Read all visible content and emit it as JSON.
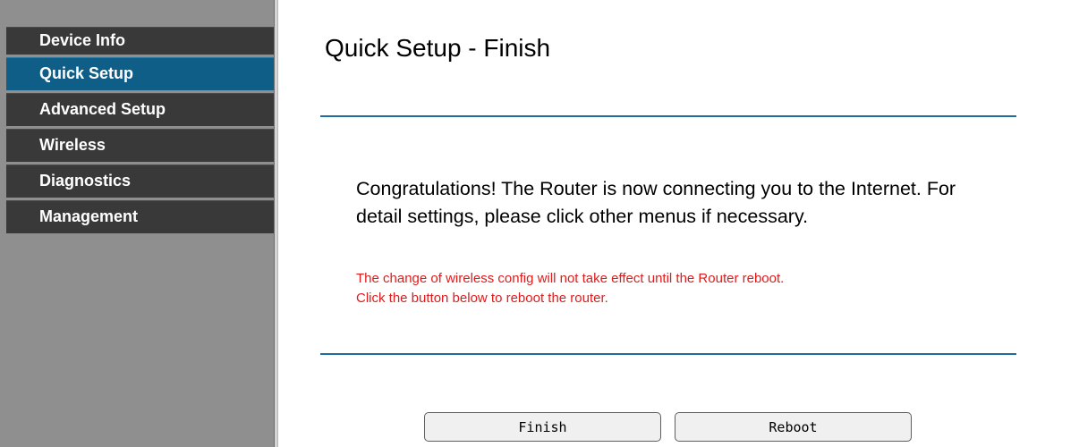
{
  "sidebar": {
    "items": [
      {
        "label": "Device Info",
        "active": false
      },
      {
        "label": "Quick Setup",
        "active": true
      },
      {
        "label": "Advanced Setup",
        "active": false
      },
      {
        "label": "Wireless",
        "active": false
      },
      {
        "label": "Diagnostics",
        "active": false
      },
      {
        "label": "Management",
        "active": false
      }
    ]
  },
  "main": {
    "title": "Quick Setup - Finish",
    "message": "Congratulations! The Router is now connecting you to the Internet. For detail settings, please click other menus if necessary.",
    "warning_line1": "The change of wireless config will not take effect until the Router reboot.",
    "warning_line2": "Click the button below to reboot the router."
  },
  "buttons": {
    "finish_label": "Finish",
    "reboot_label": "Reboot"
  },
  "colors": {
    "sidebar_bg": "#8f8f8f",
    "menu_item_bg": "#393939",
    "menu_active_bg": "#0f5e87",
    "rule": "#1e6e9c",
    "warning_text": "#e21b1b"
  }
}
